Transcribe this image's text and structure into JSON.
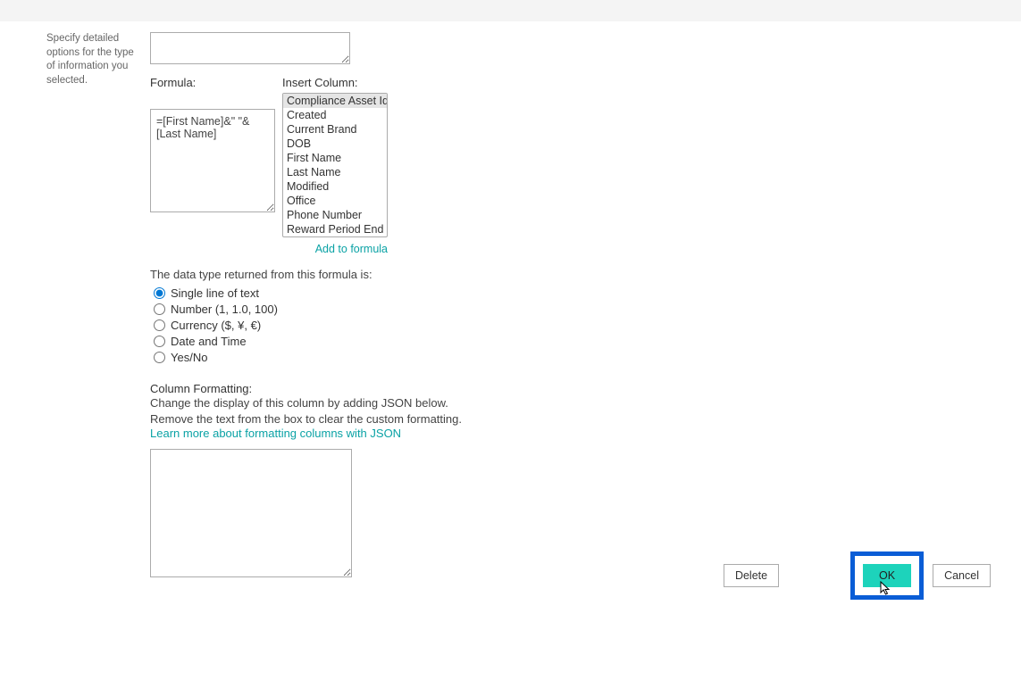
{
  "sidebar": {
    "description": "Specify detailed options for the type of information you selected."
  },
  "topTextarea": {
    "value": ""
  },
  "formula": {
    "label": "Formula:",
    "value": "=[First Name]&\" \"&[Last Name]"
  },
  "insertColumn": {
    "label": "Insert Column:",
    "options": [
      "Compliance Asset Id",
      "Created",
      "Current Brand",
      "DOB",
      "First Name",
      "Last Name",
      "Modified",
      "Office",
      "Phone Number",
      "Reward Period End"
    ],
    "selectedIndex": 0,
    "addLink": "Add to formula"
  },
  "dataType": {
    "label": "The data type returned from this formula is:",
    "options": [
      "Single line of text",
      "Number (1, 1.0, 100)",
      "Currency ($, ¥, €)",
      "Date and Time",
      "Yes/No"
    ],
    "selected": 0
  },
  "columnFormatting": {
    "heading": "Column Formatting:",
    "line1": "Change the display of this column by adding JSON below.",
    "line2": "Remove the text from the box to clear the custom formatting.",
    "link": "Learn more about formatting columns with JSON",
    "value": ""
  },
  "buttons": {
    "delete": "Delete",
    "ok": "OK",
    "cancel": "Cancel"
  }
}
